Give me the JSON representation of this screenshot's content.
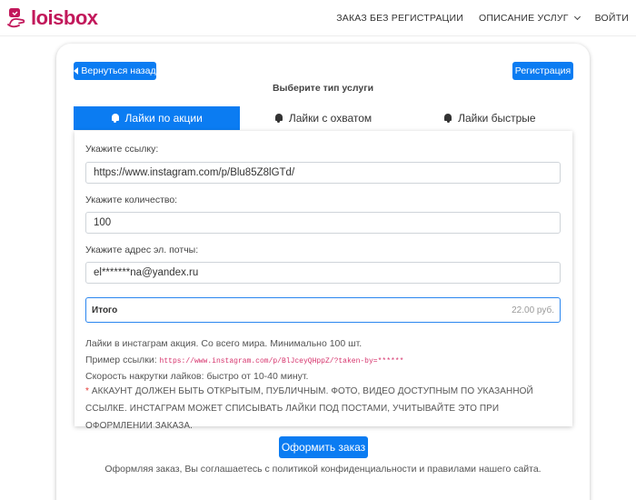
{
  "header": {
    "logo_text": "loisbox",
    "nav": [
      {
        "label": "ЗАКАЗ БЕЗ РЕГИСТРАЦИИ"
      },
      {
        "label": "ОПИСАНИЕ УСЛУГ"
      },
      {
        "label": "ВОЙТИ"
      }
    ]
  },
  "card": {
    "back_label": "Вернуться назад",
    "register_label": "Регистрация",
    "service_title": "Выберите тип услуги",
    "tabs": [
      {
        "label": "Лайки по акции",
        "active": true
      },
      {
        "label": "Лайки с охватом",
        "active": false
      },
      {
        "label": "Лайки быстрые",
        "active": false
      }
    ],
    "form": {
      "link_label": "Укажите ссылку:",
      "link_value": "https://www.instagram.com/p/Blu85Z8lGTd/",
      "qty_label": "Укажите количество:",
      "qty_value": "100",
      "email_label": "Укажите адрес эл. потчы:",
      "email_value": "el*******na@yandex.ru",
      "total_label": "Итого",
      "total_value": "22.00 руб."
    },
    "info": {
      "line1": "Лайки в инстаграм акция. Со всего мира. Минимально 100 шт.",
      "example_prefix": "Пример ссылки:",
      "example_code": "https://www.instagram.com/p/BlJceyQHppZ/?taken-by=******",
      "speed": "Скорость накрутки лайков: быстро от 10-40 минут.",
      "warning_star": "*",
      "warning_text": "АККАУНТ ДОЛЖЕН БЫТЬ ОТКРЫТЫМ, ПУБЛИЧНЫМ. ФОТО, ВИДЕО ДОСТУПНЫМ ПО УКАЗАННОЙ ССЫЛКЕ. ИНСТАГРАМ МОЖЕТ СПИСЫВАТЬ ЛАЙКИ ПОД ПОСТАМИ, УЧИТЫВАЙТЕ ЭТО ПРИ ОФОРМЛЕНИИ ЗАКАЗА."
    },
    "order_label": "Оформить заказ",
    "agreement": "Оформляя заказ, Вы соглашаетесь с политикой конфиденциальности и правилами нашего сайта."
  },
  "colors": {
    "primary": "#0b7cf2",
    "brand": "#c2185b",
    "danger": "#e53935",
    "code": "#d6336c"
  },
  "icons": [
    "logo-icon",
    "chevron-down-icon",
    "arrow-left-icon",
    "bell-icon"
  ]
}
